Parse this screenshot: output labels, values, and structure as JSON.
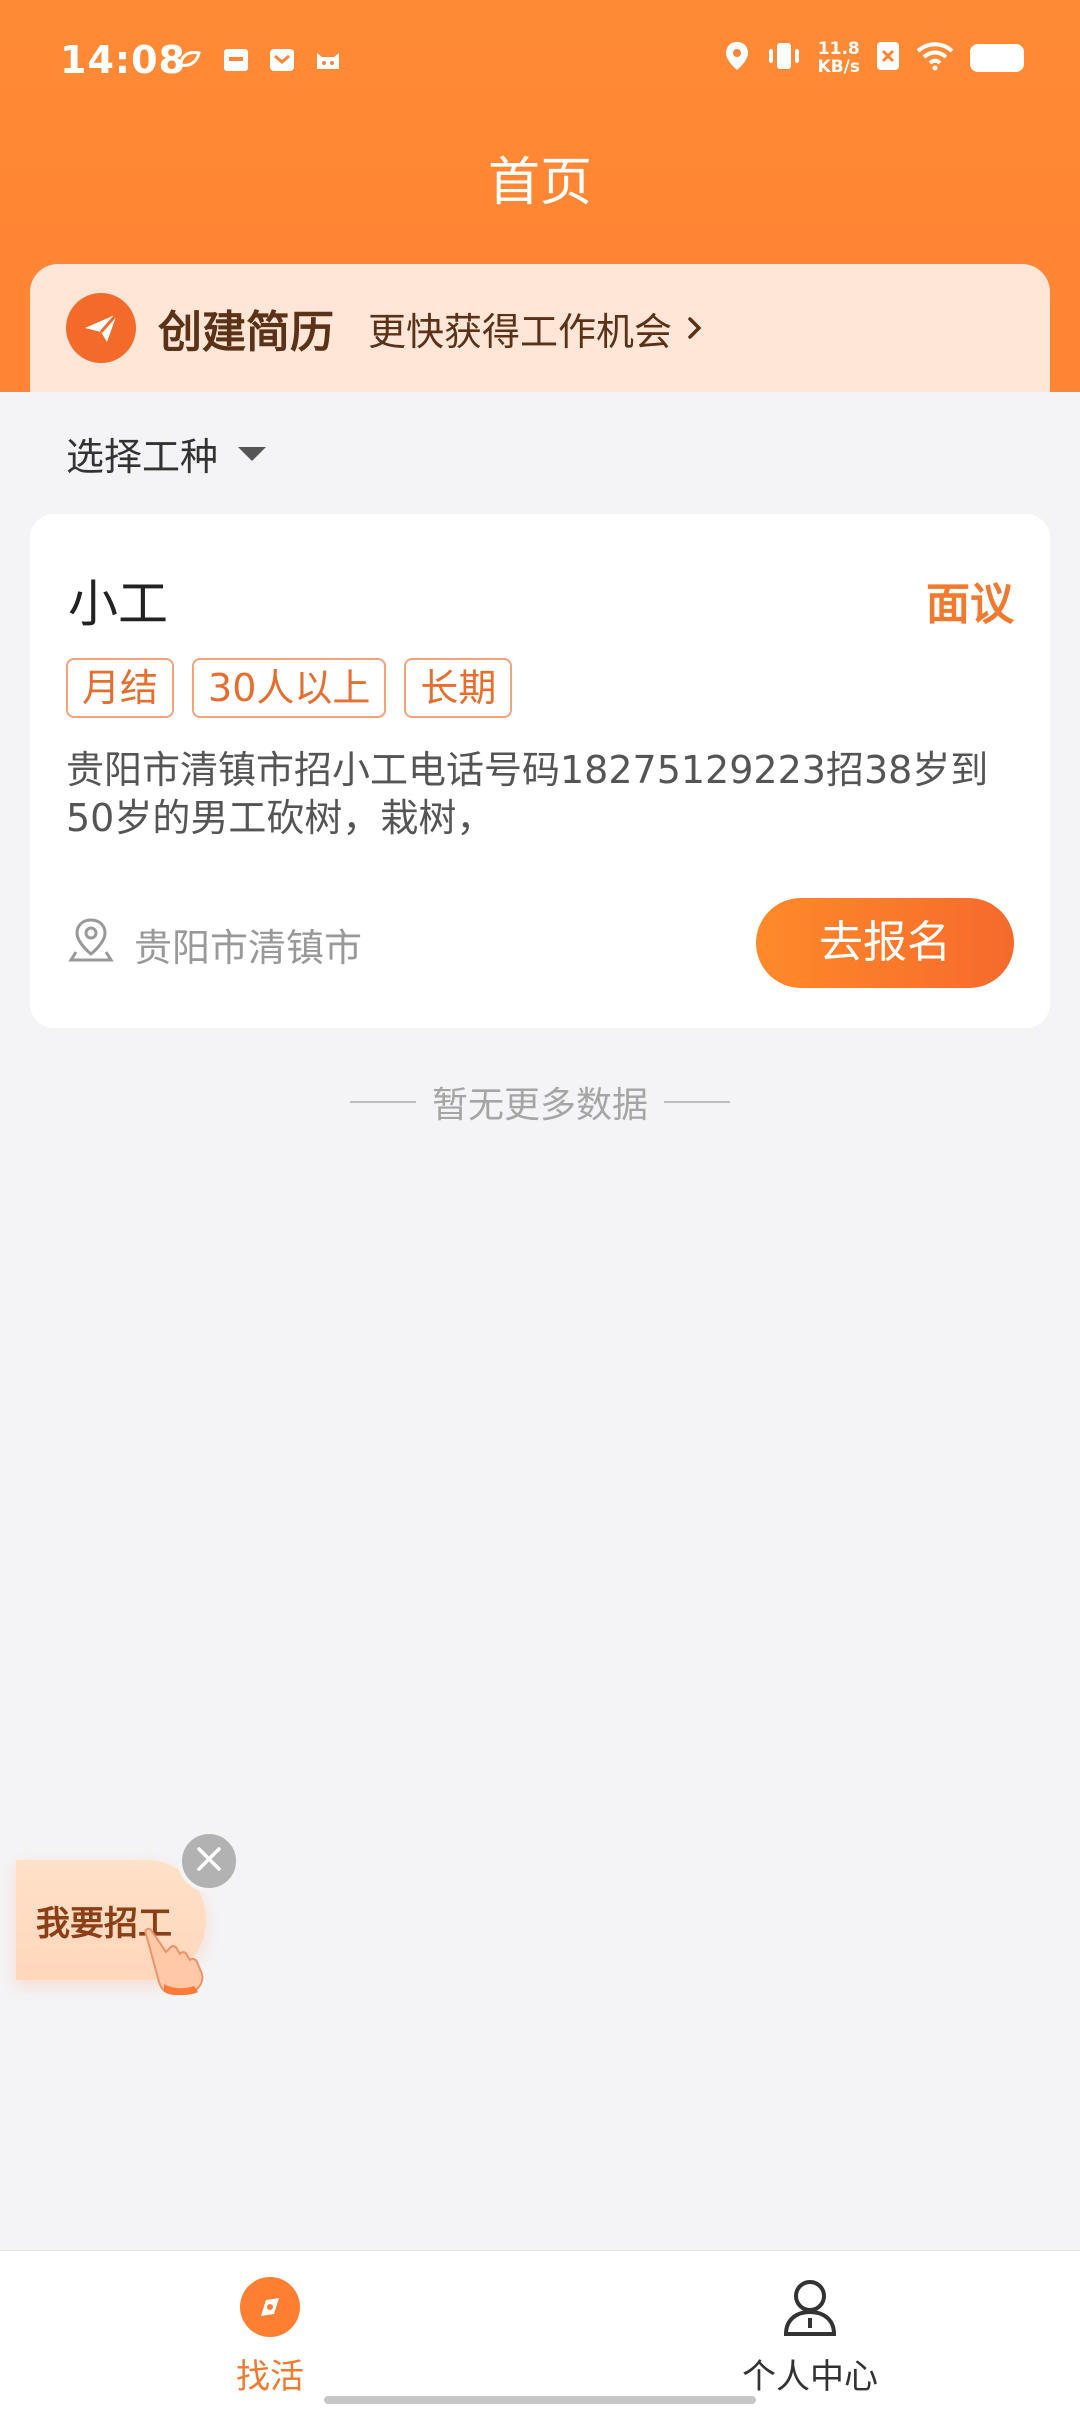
{
  "status_bar": {
    "time": "14:08",
    "net_speed_value": "11.8",
    "net_speed_unit": "KB/s"
  },
  "header": {
    "title": "首页"
  },
  "resume_banner": {
    "title": "创建简历",
    "subtitle": "更快获得工作机会"
  },
  "filter": {
    "label": "选择工种"
  },
  "job_card": {
    "title": "小工",
    "salary": "面议",
    "tags": [
      "月结",
      "30人以上",
      "长期"
    ],
    "description": "贵阳市清镇市招小工电话号码18275129223招38岁到50岁的男工砍树，栽树，",
    "location": "贵阳市清镇市",
    "apply_label": "去报名"
  },
  "no_more_text": "暂无更多数据",
  "floating": {
    "recruit_label": "我要招工"
  },
  "tabbar": {
    "items": [
      {
        "label": "找活",
        "icon": "compass-icon",
        "active": true
      },
      {
        "label": "个人中心",
        "icon": "person-icon",
        "active": false
      }
    ]
  },
  "colors": {
    "accent": "#ff8434",
    "salary": "#f07a2f",
    "banner_bg": "#ffe6d7"
  }
}
